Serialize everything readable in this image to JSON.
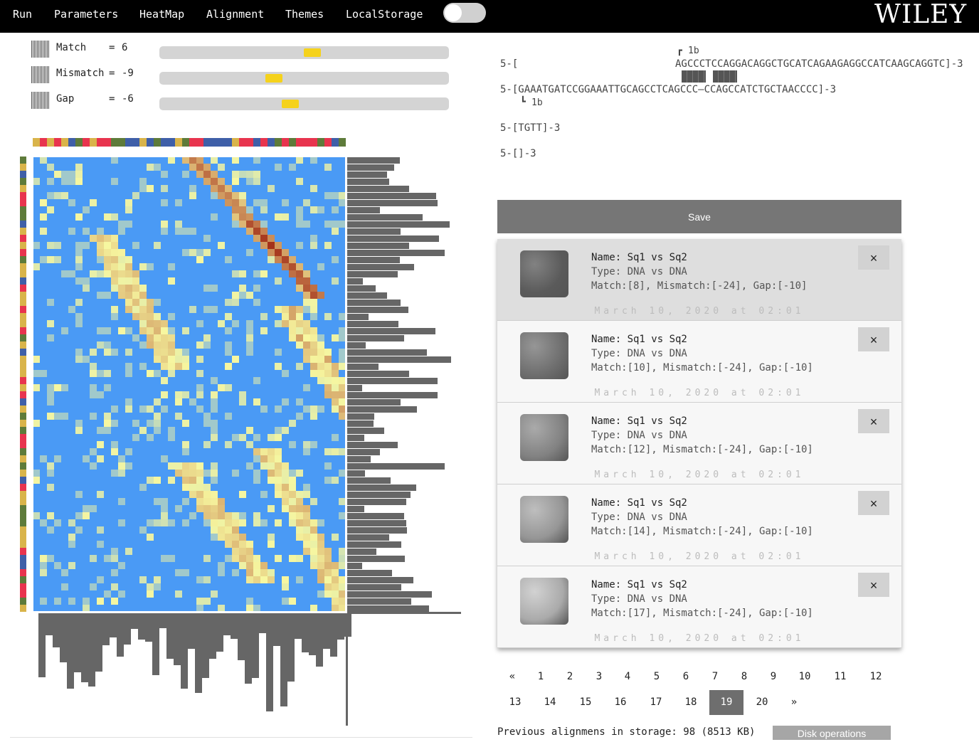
{
  "navbar": {
    "items": [
      "Run",
      "Parameters",
      "HeatMap",
      "Alignment",
      "Themes",
      "LocalStorage"
    ],
    "toggle_on": false,
    "logo": "WILEY"
  },
  "parameters": [
    {
      "name": "Match",
      "eq": "=",
      "value": "6",
      "slider_fraction": 0.53
    },
    {
      "name": "Mismatch",
      "eq": "=",
      "value": "-9",
      "slider_fraction": 0.39
    },
    {
      "name": "Gap",
      "eq": "=",
      "value": "-6",
      "slider_fraction": 0.45
    }
  ],
  "heatmap": {
    "colors": {
      "low": "#4a9af5",
      "mid": "#f7f7a0",
      "high": "#9b1b0b"
    },
    "sequence_colors": [
      "#d9b44a",
      "#e8344e",
      "#3f5fa8",
      "#5e7b3a"
    ]
  },
  "alignment": {
    "line1_prefix": "5-[",
    "line1_seq": "AGCCCTCCAGGACAGGCTGCATCAGAAGAGGCCATCAAGCAGGTC]-3",
    "mark_top": "1b",
    "line2": "5-[GAAATGATCCGGAAATTGCAGCCTCAGCCC—CCAGCCATCTGCTAACCCC]-3",
    "mark_bottom": "1b",
    "line3": "5-[TGTT]-3",
    "line4": "5-[]-3"
  },
  "save_label": "Save",
  "history": [
    {
      "name": "Name: Sq1 vs Sq2",
      "type": "Type: DNA vs DNA",
      "params": "Match:[8], Mismatch:[-24], Gap:[-10]",
      "date": "March 10, 2020 at 02:01",
      "close": "×"
    },
    {
      "name": "Name: Sq1 vs Sq2",
      "type": "Type: DNA vs DNA",
      "params": "Match:[10], Mismatch:[-24], Gap:[-10]",
      "date": "March 10, 2020 at 02:01",
      "close": "×"
    },
    {
      "name": "Name: Sq1 vs Sq2",
      "type": "Type: DNA vs DNA",
      "params": "Match:[12], Mismatch:[-24], Gap:[-10]",
      "date": "March 10, 2020 at 02:01",
      "close": "×"
    },
    {
      "name": "Name: Sq1 vs Sq2",
      "type": "Type: DNA vs DNA",
      "params": "Match:[14], Mismatch:[-24], Gap:[-10]",
      "date": "March 10, 2020 at 02:01",
      "close": "×"
    },
    {
      "name": "Name: Sq1 vs Sq2",
      "type": "Type: DNA vs DNA",
      "params": "Match:[17], Mismatch:[-24], Gap:[-10]",
      "date": "March 10, 2020 at 02:01",
      "close": "×"
    }
  ],
  "pagination": {
    "row1": [
      "«",
      "1",
      "2",
      "3",
      "4",
      "5",
      "6",
      "7",
      "8",
      "9",
      "10",
      "11",
      "12"
    ],
    "row2": [
      "13",
      "14",
      "15",
      "16",
      "17",
      "18",
      "19",
      "20",
      "»"
    ],
    "current": "19"
  },
  "storage": {
    "text": "Previous alignmens in storage: 98 (8513 KB)",
    "disk_label": "Disk operations"
  }
}
